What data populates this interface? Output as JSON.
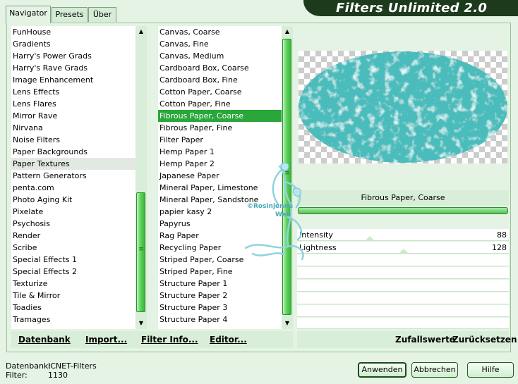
{
  "title": "Filters Unlimited 2.0",
  "tabs": [
    {
      "label": "Navigator"
    },
    {
      "label": "Presets"
    },
    {
      "label": "Über"
    }
  ],
  "categories": [
    "FunHouse",
    "Gradients",
    "Harry's Power Grads",
    "Harry's Rave Grads",
    "Image Enhancement",
    "Lens Effects",
    "Lens Flares",
    "Mirror Rave",
    "Nirvana",
    "Noise Filters",
    "Paper Backgrounds",
    "Paper Textures",
    "Pattern Generators",
    "penta.com",
    "Photo Aging Kit",
    "Pixelate",
    "Psychosis",
    "Render",
    "Scribe",
    "Special Effects 1",
    "Special Effects 2",
    "Texturize",
    "Tile & Mirror",
    "Toadies",
    "Tramages"
  ],
  "selected_category": "Paper Textures",
  "filters": [
    "Canvas, Coarse",
    "Canvas, Fine",
    "Canvas, Medium",
    "Cardboard Box, Coarse",
    "Cardboard Box, Fine",
    "Cotton Paper, Coarse",
    "Cotton Paper, Fine",
    "Fibrous Paper, Coarse",
    "Fibrous Paper, Fine",
    "Filter Paper",
    "Hemp Paper 1",
    "Hemp Paper 2",
    "Japanese Paper",
    "Mineral Paper, Limestone",
    "Mineral Paper, Sandstone",
    "papier kasy 2",
    "Papyrus",
    "Rag Paper",
    "Recycling Paper",
    "Striped Paper, Coarse",
    "Striped Paper, Fine",
    "Structure Paper 1",
    "Structure Paper 2",
    "Structure Paper 3",
    "Structure Paper 4"
  ],
  "selected_filter": "Fibrous Paper, Coarse",
  "filter_caption": "Fibrous Paper, Coarse",
  "params": [
    {
      "label": "Intensity",
      "value": "88",
      "fraction": 0.345
    },
    {
      "label": "Lightness",
      "value": "128",
      "fraction": 0.502
    }
  ],
  "commands": {
    "datenbank": "Datenbank",
    "import": "Import...",
    "filter_info": "Filter Info...",
    "editor": "Editor...",
    "zufallswerte": "Zufallswerte",
    "zuruecksetzen": "Zurücksetzen"
  },
  "status": {
    "db_label": "Datenbank:",
    "db_value": "ICNET-Filters",
    "filter_label": "Filter:",
    "filter_value": "1130"
  },
  "buttons": {
    "apply": "Anwenden",
    "cancel": "Abbrechen",
    "help": "Hilfe"
  },
  "watermark": {
    "line1": "©Rosinjenne",
    "line2": "Web"
  },
  "colors": {
    "accent": "#2aa63a",
    "banner": "#1d3a1d",
    "panel": "#e4f3e4",
    "preview_texture": "#4cbcbc"
  },
  "icons": {
    "scroll_up": "scroll-up-arrow-icon",
    "scroll_down": "scroll-down-arrow-icon",
    "scroll_grip": "scroll-grip-icon"
  }
}
